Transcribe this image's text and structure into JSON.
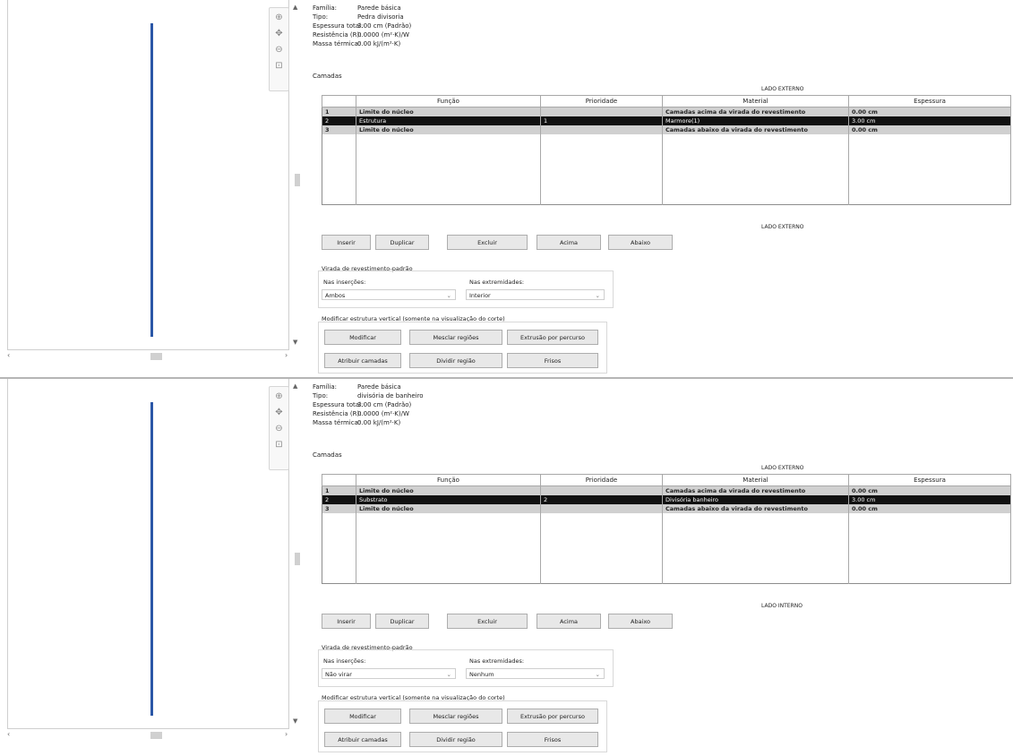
{
  "top": {
    "properties": {
      "familia_label": "Família:",
      "familia_value": "Parede básica",
      "tipo_label": "Tipo:",
      "tipo_value": "Pedra divisoria",
      "espessura_label": "Espessura total:",
      "espessura_value": "3.00 cm (Padrão)",
      "resistencia_label": "Resistência (R):",
      "resistencia_value": "0.0000 (m²·K)/W",
      "massa_label": "Massa térmica:",
      "massa_value": "0.00 kJ/(m²·K)"
    },
    "camadas_label": "Camadas",
    "lado_externo_top": "LADO EXTERNO",
    "lado_externo_bottom": "LADO EXTERNO",
    "columns": [
      "",
      "Função",
      "Prioridade",
      "Material",
      "Espessura"
    ],
    "rows": [
      {
        "num": "1",
        "funcao": "Limite do núcleo",
        "prioridade": "",
        "material": "Camadas acima da virada do revestimento",
        "espessura": "0.00 cm"
      },
      {
        "num": "2",
        "funcao": "Estrutura",
        "prioridade": "1",
        "material": "Marmore(1)",
        "espessura": "3.00 cm"
      },
      {
        "num": "3",
        "funcao": "Limite do núcleo",
        "prioridade": "",
        "material": "Camadas abaixo da virada do revestimento",
        "espessura": "0.00 cm"
      }
    ],
    "buttons": {
      "inserir": "Inserir",
      "duplicar": "Duplicar",
      "excluir": "Excluir",
      "acima": "Acima",
      "abaixo": "Abaixo"
    },
    "virada": {
      "title": "Virada de revestimento-padrão",
      "insercoes_label": "Nas inserções:",
      "insercoes_value": "Ambos",
      "extremidades_label": "Nas extremidades:",
      "extremidades_value": "Interior"
    },
    "estrutura": {
      "title": "Modificar estrutura vertical (somente na visualização do corte)",
      "modificar": "Modificar",
      "mesclar": "Mesclar regiões",
      "extrusao": "Extrusão por percurso",
      "atribuir": "Atribuir camadas",
      "dividir": "Dividir região",
      "frisos": "Frisos"
    }
  },
  "bottom": {
    "properties": {
      "familia_label": "Família:",
      "familia_value": "Parede básica",
      "tipo_label": "Tipo:",
      "tipo_value": "divisória de banheiro",
      "espessura_label": "Espessura total:",
      "espessura_value": "3.00 cm (Padrão)",
      "resistencia_label": "Resistência (R):",
      "resistencia_value": "0.0000 (m²·K)/W",
      "massa_label": "Massa térmica:",
      "massa_value": "0.00 kJ/(m²·K)"
    },
    "camadas_label": "Camadas",
    "lado_externo_top": "LADO EXTERNO",
    "lado_externo_bottom": "LADO INTERNO",
    "columns": [
      "",
      "Função",
      "Prioridade",
      "Material",
      "Espessura"
    ],
    "rows": [
      {
        "num": "1",
        "funcao": "Limite do núcleo",
        "prioridade": "",
        "material": "Camadas acima da virada do revestimento",
        "espessura": "0.00 cm"
      },
      {
        "num": "2",
        "funcao": "Substrato",
        "prioridade": "2",
        "material": "Divisória banheiro",
        "espessura": "3.00 cm"
      },
      {
        "num": "3",
        "funcao": "Limite do núcleo",
        "prioridade": "",
        "material": "Camadas abaixo da virada do revestimento",
        "espessura": "0.00 cm"
      }
    ],
    "buttons": {
      "inserir": "Inserir",
      "duplicar": "Duplicar",
      "excluir": "Excluir",
      "acima": "Acima",
      "abaixo": "Abaixo"
    },
    "virada": {
      "title": "Virada de revestimento-padrão",
      "insercoes_label": "Nas inserções:",
      "insercoes_value": "Não virar",
      "extremidades_label": "Nas extremidades:",
      "extremidades_value": "Nenhum"
    },
    "estrutura": {
      "title": "Modificar estrutura vertical (somente na visualização do corte)",
      "modificar": "Modificar",
      "mesclar": "Mesclar regiões",
      "extrusao": "Extrusão por percurso",
      "atribuir": "Atribuir camadas",
      "dividir": "Dividir região",
      "frisos": "Frisos"
    }
  },
  "icons": {
    "zoom": "zoom-in-icon",
    "pan": "pan-icon",
    "zoom_out": "zoom-out-icon",
    "scroll_up": "scroll-up-icon",
    "scroll_down": "scroll-down-icon",
    "scroll_left": "scroll-left-icon",
    "scroll_right": "scroll-right-icon",
    "chevron": "chevron-down-icon"
  },
  "colors": {
    "wall_line": "#2b57a7",
    "selected_row": "#111111",
    "core_boundary_row": "#d0d0d0"
  }
}
